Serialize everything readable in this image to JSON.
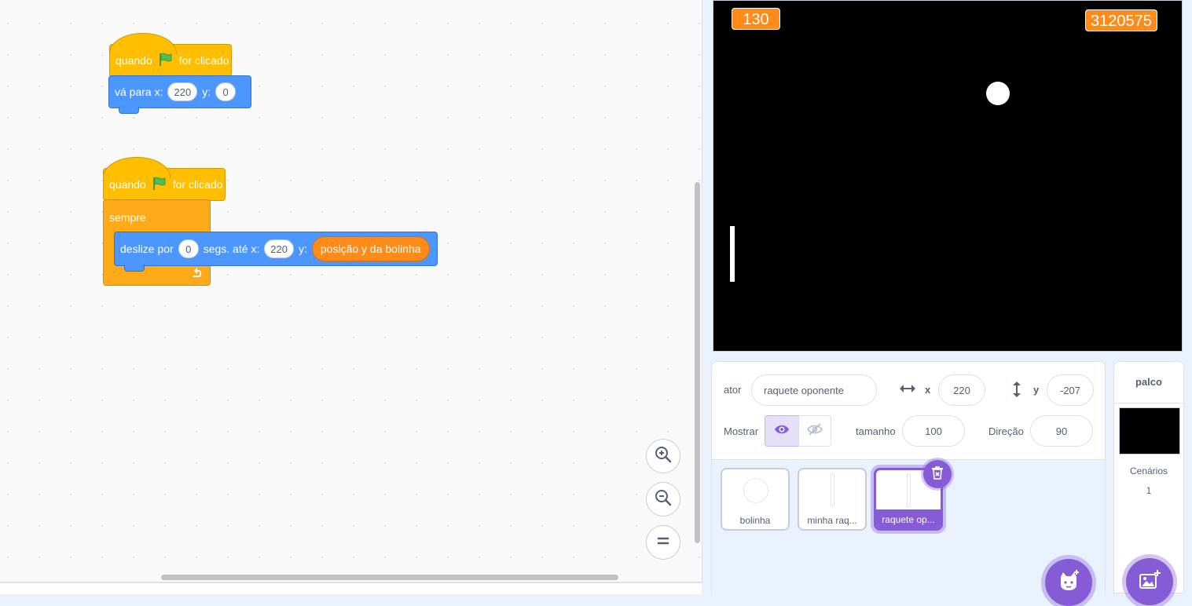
{
  "code": {
    "script1": {
      "hat_prefix": "quando",
      "hat_suffix": "for clicado",
      "goto_label": "vá para x:",
      "goto_x": "220",
      "goto_y_label": "y:",
      "goto_y": "0"
    },
    "script2": {
      "hat_prefix": "quando",
      "hat_suffix": "for clicado",
      "forever_label": "sempre",
      "glide_label": "deslize por",
      "glide_secs": "0",
      "glide_to_label": "segs. até x:",
      "glide_x": "220",
      "glide_y_label": "y:",
      "glide_y_reporter": "posição y da bolinha"
    },
    "zoom_in_icon": "zoom-in",
    "zoom_out_icon": "zoom-out",
    "zoom_reset_icon": "equals"
  },
  "stage": {
    "monitor_left": "130",
    "monitor_right": "3120575"
  },
  "sprite_info": {
    "sprite_label": "ator",
    "sprite_name": "raquete oponente",
    "x_label": "x",
    "x_value": "220",
    "y_label": "y",
    "y_value": "-207",
    "show_label": "Mostrar",
    "size_label": "tamanho",
    "size_value": "100",
    "direction_label": "Direção",
    "direction_value": "90"
  },
  "sprites": [
    {
      "name": "bolinha"
    },
    {
      "name": "minha raq..."
    },
    {
      "name": "raquete op..."
    }
  ],
  "stage_pane": {
    "title": "palco",
    "backdrops_label": "Cenários",
    "backdrops_count": "1"
  },
  "colors": {
    "events": "#ffbf00",
    "motion": "#4c97ff",
    "control": "#ffab19",
    "sensing": "#ff8c1a",
    "accent": "#855cd6"
  }
}
